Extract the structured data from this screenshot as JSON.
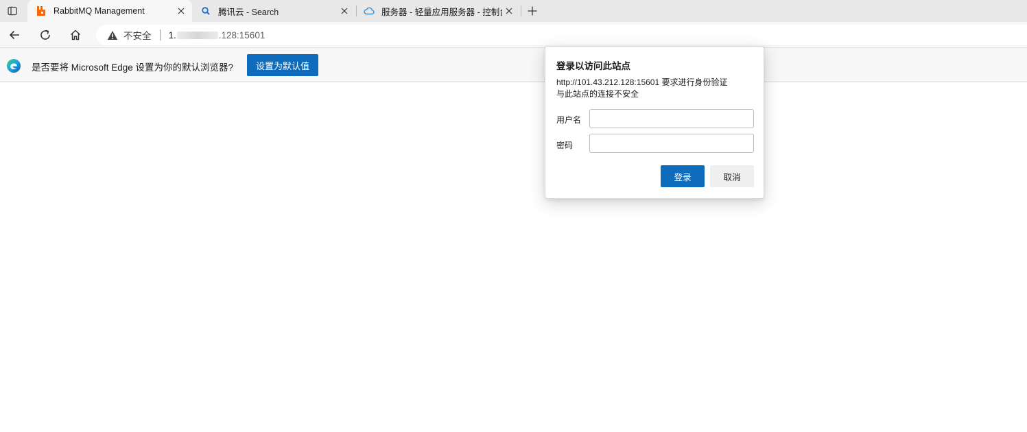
{
  "tabs": [
    {
      "title": "RabbitMQ Management",
      "favicon": "rabbitmq-icon",
      "active": true
    },
    {
      "title": "腾讯云 - Search",
      "favicon": "search-icon",
      "active": false
    },
    {
      "title": "服务器 - 轻量应用服务器 - 控制台",
      "favicon": "cloud-icon",
      "active": false
    }
  ],
  "address_bar": {
    "security_label": "不安全",
    "url_prefix": "1.",
    "url_suffix": ".128:15601"
  },
  "infobar": {
    "message": "是否要将 Microsoft Edge 设置为你的默认浏览器?",
    "button_label": "设置为默认值"
  },
  "auth_dialog": {
    "title": "登录以访问此站点",
    "message_line1": "http://101.43.212.128:15601 要求进行身份验证",
    "message_line2": "与此站点的连接不安全",
    "username_label": "用户名",
    "username_value": "",
    "password_label": "密码",
    "password_value": "",
    "ok_label": "登录",
    "cancel_label": "取消"
  },
  "colors": {
    "accent": "#0f6cbd",
    "rabbitmq_orange": "#ff6600",
    "tab_strip": "#e8e8e8",
    "toolbar": "#f7f7f7"
  }
}
